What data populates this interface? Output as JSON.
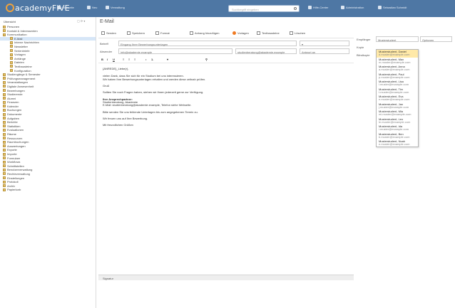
{
  "app": {
    "logo_text": "academyFIVE"
  },
  "topnav": [
    {
      "label": "Startseite",
      "icon": "home-icon"
    },
    {
      "label": "Neu",
      "icon": "plus-icon"
    },
    {
      "label": "Verwaltung",
      "icon": "list-icon"
    }
  ],
  "search": {
    "placeholder": "Suchbegriff eingeben"
  },
  "user_nav": [
    {
      "label": "Hilfe-Center",
      "icon": "help-icon"
    },
    {
      "label": "Administration",
      "icon": "admin-icon"
    },
    {
      "label": "Sebastian Schmidt",
      "icon": "user-icon"
    }
  ],
  "sidebar": {
    "header": "Übersicht",
    "items": [
      {
        "label": "Personen"
      },
      {
        "label": "Kontakt & Interessenten"
      },
      {
        "label": "Kommunikation"
      },
      {
        "label": "E-Mail",
        "selected": true
      },
      {
        "label": "Interne Nachrichten"
      },
      {
        "label": "Newsletter"
      },
      {
        "label": "Serienbriefe"
      },
      {
        "label": "Vorlagen"
      },
      {
        "label": "Anhänge"
      },
      {
        "label": "Dateien"
      },
      {
        "label": "Textbausteine"
      },
      {
        "label": "Konfiguration"
      },
      {
        "label": "Studiengänge & Semester"
      },
      {
        "label": "Prüfungsmanagement"
      },
      {
        "label": "Veranstaltungen"
      },
      {
        "label": "Digitale Anwesenheit"
      },
      {
        "label": "Bewerbungen"
      },
      {
        "label": "Studierende"
      },
      {
        "label": "Alumni"
      },
      {
        "label": "Finanzen"
      },
      {
        "label": "Kalender"
      },
      {
        "label": "Buchungen"
      },
      {
        "label": "Dokumente"
      },
      {
        "label": "Aufgaben"
      },
      {
        "label": "Berichte"
      },
      {
        "label": "Statistiken"
      },
      {
        "label": "Evaluationen"
      },
      {
        "label": "Räume"
      },
      {
        "label": "Ressourcen"
      },
      {
        "label": "Raumbuchungen"
      },
      {
        "label": "Auswertungen"
      },
      {
        "label": "Exporte"
      },
      {
        "label": "Importe"
      },
      {
        "label": "Formulare"
      },
      {
        "label": "Workflows"
      },
      {
        "label": "Schnittstellen"
      },
      {
        "label": "Benutzerverwaltung"
      },
      {
        "label": "Rechteverwaltung"
      },
      {
        "label": "Einstellungen"
      },
      {
        "label": "Protokoll"
      },
      {
        "label": "Archiv"
      },
      {
        "label": "Papierkorb"
      }
    ]
  },
  "main": {
    "title": "E-Mail",
    "toolbar": [
      {
        "label": "Senden",
        "icon": "send-icon"
      },
      {
        "label": "Speichern",
        "icon": "save-icon"
      },
      {
        "label": "Format",
        "icon": "format-icon"
      },
      {
        "label": "Anhang hinzufügen",
        "icon": "attach-icon"
      },
      {
        "label": "Vorlagen",
        "icon": "template-icon"
      },
      {
        "label": "Textbausteine",
        "icon": "text-icon"
      },
      {
        "label": "Löschen",
        "icon": "delete-icon"
      }
    ],
    "subject_label": "Betreff",
    "subject_value": "Eingang Ihrer Bewerbungsunterlagen",
    "from_label": "Absender",
    "from_value": "info@akademie.example",
    "reply_label": "Antwort an",
    "reply_value": "studienberatung@akademie.example",
    "editor_lines": [
      {
        "text": "{ANREDE}_Liebe(r),",
        "bold": false
      },
      {
        "text": "vielen Dank, dass Sie sich für ein Studium bei uns interessieren.",
        "bold": false
      },
      {
        "text": "Wir haben Ihre Bewerbungsunterlagen erhalten und werden diese zeitnah prüfen.",
        "bold": false
      },
      {
        "text": "Gruß",
        "bold": false
      },
      {
        "text": "Sollten Sie noch Fragen haben, stehen wir Ihnen jederzeit gerne zur Verfügung.",
        "bold": false
      },
      {
        "text": "Ihre Ansprechpartner:",
        "bold": true
      },
      {
        "text": "Studienberatung, Akademie",
        "bold": false
      },
      {
        "text": "E-Mail: studienberatung@akademie.example, Telefon siehe Webseite.",
        "bold": false
      },
      {
        "text": "Bitte senden Sie uns fehlende Unterlagen bis zum angegebenen Termin zu.",
        "bold": false
      },
      {
        "text": "Wir freuen uns auf Ihre Bewerbung.",
        "bold": false
      },
      {
        "text": "Mit freundlichen Grüßen",
        "bold": false
      }
    ],
    "footer_label": "Signatur"
  },
  "right": {
    "recipient_label": "Empfänger",
    "recipient_value": "Musterstudent",
    "cc_label": "Kopie",
    "bcc_label": "Blindkopie",
    "options_label": "Optionen"
  },
  "dropdown": [
    {
      "name": "Musterstudent, Daniel",
      "mail": "d.muster@example.com",
      "highlight": true
    },
    {
      "name": "Musterstudent, Max",
      "mail": "m.muster@example.com"
    },
    {
      "name": "Musterstudent, Anna",
      "mail": "a.muster@example.com"
    },
    {
      "name": "Musterstudent, Paul",
      "mail": "p.muster@example.com"
    },
    {
      "name": "Musterstudent, Lisa",
      "mail": "l.muster@example.com"
    },
    {
      "name": "Musterstudent, Tim",
      "mail": "t.muster@example.com"
    },
    {
      "name": "Musterstudent, Eva",
      "mail": "e.muster@example.com"
    },
    {
      "name": "Musterstudent, Jan",
      "mail": "j.muster@example.com"
    },
    {
      "name": "Musterstudent, Mia",
      "mail": "mi.muster@example.com"
    },
    {
      "name": "Musterstudent, Leo",
      "mail": "le.muster@example.com"
    },
    {
      "name": "Musterstudent, Ida",
      "mail": "i.muster@example.com"
    },
    {
      "name": "Musterstudent, Ben",
      "mail": "b.muster@example.com"
    },
    {
      "name": "Musterstudent, Noah",
      "mail": "n.muster@example.com"
    }
  ]
}
